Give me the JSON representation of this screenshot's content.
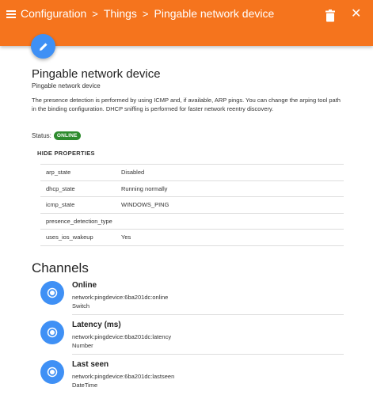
{
  "header": {
    "breadcrumbs": [
      "Configuration",
      "Things",
      "Pingable network device"
    ],
    "separator": ">",
    "accent_color": "#f5741d"
  },
  "thing": {
    "title": "Pingable network device",
    "subtitle": "Pingable network device",
    "description": "The presence detection is performed by using ICMP and, if available, ARP pings. You can change the arping tool path in the binding configuration. DHCP sniffing is performed for faster network reentry discovery.",
    "status_label": "Status:",
    "status_value": "ONLINE",
    "status_color": "#2e8b2e"
  },
  "properties": {
    "toggle_label": "HIDE PROPERTIES",
    "rows": [
      {
        "name": "arp_state",
        "value": "Disabled"
      },
      {
        "name": "dhcp_state",
        "value": "Running normally"
      },
      {
        "name": "icmp_state",
        "value": "WINDOWS_PING"
      },
      {
        "name": "presence_detection_type",
        "value": ""
      },
      {
        "name": "uses_ios_wakeup",
        "value": "Yes"
      }
    ]
  },
  "channels": {
    "title": "Channels",
    "items": [
      {
        "name": "Online",
        "uid": "network:pingdevice:6ba201dc:online",
        "type": "Switch"
      },
      {
        "name": "Latency (ms)",
        "uid": "network:pingdevice:6ba201dc:latency",
        "type": "Number"
      },
      {
        "name": "Last seen",
        "uid": "network:pingdevice:6ba201dc:lastseen",
        "type": "DateTime"
      }
    ]
  },
  "icons": {
    "menu": "hamburger-menu-icon",
    "delete": "trash-icon",
    "close": "close-icon",
    "edit": "pencil-icon",
    "channel": "radio-dot-icon"
  }
}
